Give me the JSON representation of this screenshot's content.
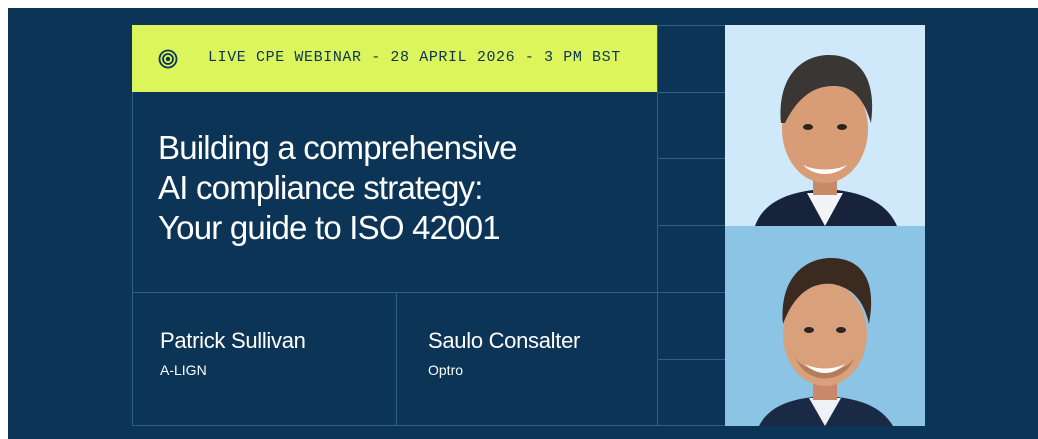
{
  "banner": {
    "live_label": "LIVE CPE WEBINAR - 28 APRIL 2026 - 3 PM BST",
    "title_lines": [
      "Building a comprehensive",
      "AI compliance strategy:",
      "Your guide to ISO 42001"
    ],
    "speakers": [
      {
        "name": "Patrick Sullivan",
        "org": "A-LIGN"
      },
      {
        "name": "Saulo Consalter",
        "org": "Optro"
      }
    ],
    "colors": {
      "background": "#0c3456",
      "accent": "#dcf55b",
      "photo_top_bg": "#cfe9fb",
      "photo_bottom_bg": "#8cc4e6"
    },
    "icons": [
      "live-broadcast-icon"
    ]
  }
}
